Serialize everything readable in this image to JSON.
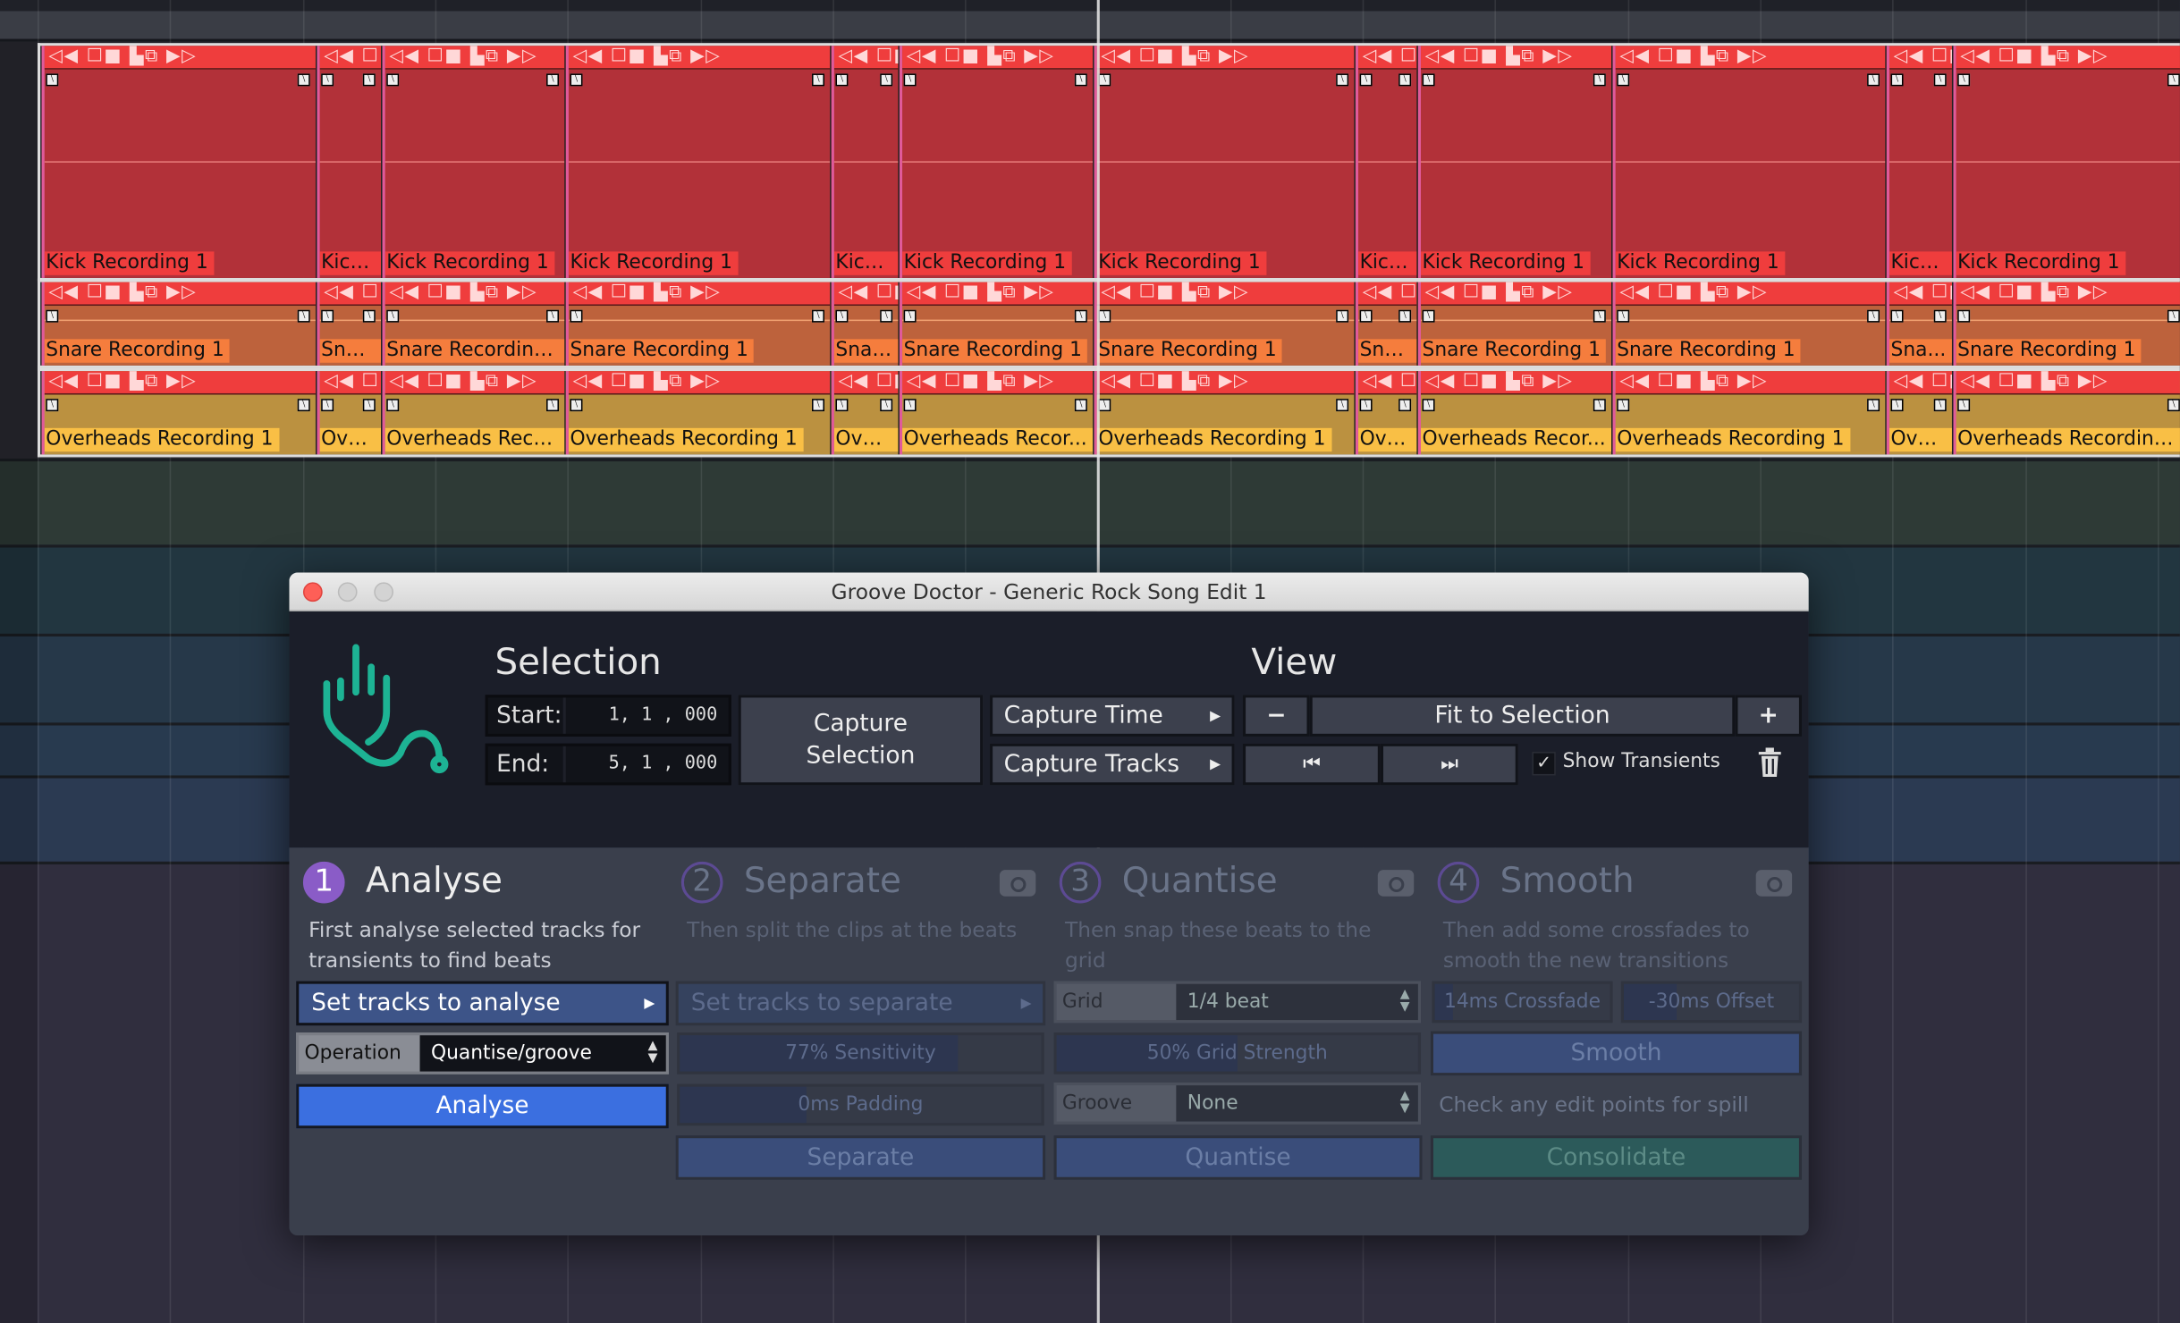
{
  "timeline": {
    "tracks": [
      {
        "name": "kick",
        "body_color": "#b23139",
        "label_color": "#ef3d3d",
        "wave_color": "#e77a7a",
        "clips": [
          "Kick Recording 1",
          "Kick ...",
          "Kick Recording 1",
          "Kick Recording 1",
          "Kick ...",
          "Kick Recording 1",
          "Kick Recording 1",
          "Kick...",
          "Kick Recording 1",
          "Kick Recording 1",
          "Kick...",
          "Kick Recording 1"
        ]
      },
      {
        "name": "snare",
        "body_color": "#bd623c",
        "label_color": "#f57d3d",
        "wave_color": "#f0a070",
        "clips": [
          "Snare Recording 1",
          "Snar...",
          "Snare Recording 1",
          "Snare Recording 1",
          "Snar...",
          "Snare Recording 1",
          "Snare Recording 1",
          "Sna...",
          "Snare Recording 1",
          "Snare Recording 1",
          "Sna...",
          "Snare Recording 1"
        ]
      },
      {
        "name": "overheads",
        "body_color": "#bb9140",
        "label_color": "#f9bf45",
        "wave_color": "#e0b060",
        "clips": [
          "Overheads Recording 1",
          "Ove...",
          "Overheads Reco...",
          "Overheads Recording 1",
          "Ove...",
          "Overheads Recor...",
          "Overheads Recording 1",
          "Ove...",
          "Overheads Recor...",
          "Overheads Recording 1",
          "Ove...",
          "Overheads Recording 1"
        ]
      }
    ],
    "clip_header_icons": "◁◀ ☐■ ▙⧉ ▶▷"
  },
  "dialog": {
    "title": "Groove Doctor - Generic Rock Song Edit 1",
    "selection": {
      "heading": "Selection",
      "start_label": "Start:",
      "start_value": "1, 1 , 000",
      "end_label": "End:",
      "end_value": "5, 1 , 000",
      "capture_selection": "Capture Selection",
      "capture_time": "Capture Time",
      "capture_tracks": "Capture Tracks"
    },
    "view": {
      "heading": "View",
      "zoom_out": "−",
      "fit": "Fit to Selection",
      "zoom_in": "+",
      "prev": "⏮",
      "next": "⏭",
      "show_transients": "Show Transients",
      "show_transients_checked": true
    },
    "steps": [
      {
        "number": "1",
        "title": "Analyse",
        "desc": "First analyse selected tracks for transients to find beats",
        "active": true
      },
      {
        "number": "2",
        "title": "Separate",
        "desc": "Then split the clips at the beats",
        "active": false
      },
      {
        "number": "3",
        "title": "Quantise",
        "desc": "Then snap these beats to the grid",
        "active": false
      },
      {
        "number": "4",
        "title": "Smooth",
        "desc": "Then add some crossfades to smooth the new transitions",
        "active": false
      }
    ],
    "analyse": {
      "set_tracks": "Set tracks to analyse",
      "operation_label": "Operation",
      "operation_value": "Quantise/groove",
      "button": "Analyse"
    },
    "separate": {
      "set_tracks": "Set tracks to separate",
      "sensitivity": "77% Sensitivity",
      "sensitivity_pct": 77,
      "padding": "0ms Padding",
      "padding_pct": 35,
      "button": "Separate"
    },
    "quantise": {
      "grid_label": "Grid",
      "grid_value": "1/4 beat",
      "strength": "50% Grid Strength",
      "strength_pct": 50,
      "groove_label": "Groove",
      "groove_value": "None",
      "button": "Quantise"
    },
    "smooth": {
      "crossfade": "14ms Crossfade",
      "crossfade_pct": 10,
      "offset": "-30ms Offset",
      "offset_pct": 30,
      "button": "Smooth",
      "note": "Check any edit points for spill",
      "consolidate": "Consolidate"
    },
    "colors": {
      "accent_blue": "#3b6fe0",
      "step_purple": "#8a5cc7",
      "logo_teal": "#1db394",
      "consolidate": "#2c5a5a"
    }
  }
}
